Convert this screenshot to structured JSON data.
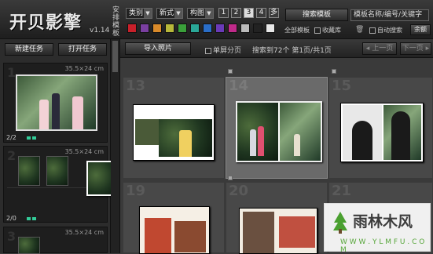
{
  "app": {
    "logo": "开贝影擎",
    "version": "v1.14",
    "vertical_label": "安排模板"
  },
  "toolbar": {
    "dropdowns": [
      "类别",
      "新式",
      "构图"
    ],
    "page_numbers": [
      "1",
      "2",
      "3",
      "4",
      "多"
    ],
    "active_page": "3",
    "swatches": [
      "#c8202a",
      "#7a3fa0",
      "#d98a2a",
      "#b8b83a",
      "#3aa03a",
      "#2aa898",
      "#2a6ec8",
      "#6a3ab8",
      "#c02a8a",
      "#bbbbbb",
      "#222222",
      "#e8e8e8"
    ],
    "search_button": "搜索模板",
    "search_placeholder": "模板名称/编号/关键字",
    "all_templates": "全部模板",
    "favorites": "收藏库",
    "auto_search": "自动搜索",
    "balance_button": "余额"
  },
  "left": {
    "new_task": "新建任务",
    "open_task": "打开任务",
    "slots": [
      {
        "num": "1",
        "size": "35.5×24 cm",
        "count": "2/2"
      },
      {
        "num": "2",
        "size": "35.5×24 cm",
        "count": "2/0"
      },
      {
        "num": "3",
        "size": "35.5×24 cm",
        "count": ""
      }
    ]
  },
  "midbar": {
    "import_button": "导入照片",
    "single_page": "单屏分页",
    "status": "搜索到72个 第1页/共1页",
    "prev": "上一页",
    "next": "下一页"
  },
  "grid": {
    "cells": [
      "13",
      "14",
      "15",
      "19",
      "20",
      "21"
    ]
  },
  "watermark": {
    "title": "雨林木风",
    "url": "W W W . Y L M F U . C O M"
  }
}
